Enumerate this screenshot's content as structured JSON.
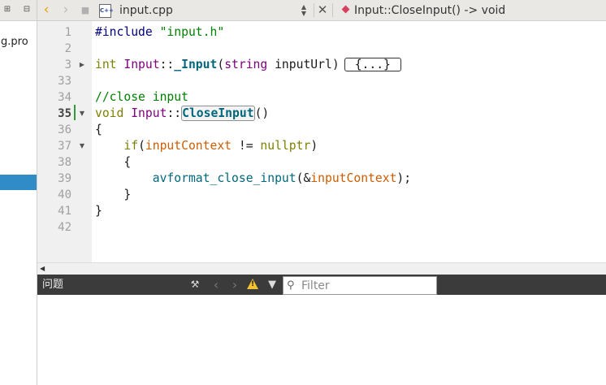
{
  "left_panel": {
    "project_label": "g.pro",
    "toolbar_icons": [
      "split-icon",
      "close-panel-icon"
    ]
  },
  "editor_toolbar": {
    "back_icon": "chevron-left-icon",
    "forward_icon": "chevron-right-icon",
    "lock_icon": "lock-icon",
    "file_type_label": "C++",
    "file_name": "input.cpp",
    "dropdown_icon": "up-down-arrows-icon",
    "close_icon": "close-icon",
    "symbol_icon": "diamond-icon",
    "symbol_label": "Input::CloseInput() -> void"
  },
  "editor": {
    "line_numbers": [
      "1",
      "2",
      "3",
      "33",
      "34",
      "35",
      "36",
      "37",
      "38",
      "39",
      "40",
      "41",
      "42"
    ],
    "current_line": "35",
    "code": {
      "l1_directive": "#include",
      "l1_string": "\"input.h\"",
      "l3_kw": "int",
      "l3_class": "Input",
      "l3_sep": "::",
      "l3_func": "_Input",
      "l3_open": "(",
      "l3_type": "string",
      "l3_param": "inputUrl",
      "l3_close": ")",
      "l3_folded": "{...}",
      "l34_comment": "//close input",
      "l35_kw": "void",
      "l35_class": "Input",
      "l35_sep": "::",
      "l35_func": "CloseInput",
      "l35_parens": "()",
      "l36_brace": "{",
      "l37_kw": "if",
      "l37_open": "(",
      "l37_var": "inputContext",
      "l37_op": " != ",
      "l37_null": "nullptr",
      "l37_close": ")",
      "l38_brace": "{",
      "l39_func": "avformat_close_input",
      "l39_open": "(&",
      "l39_var": "inputContext",
      "l39_close": ");",
      "l40_brace": "}",
      "l41_brace": "}"
    }
  },
  "issues_panel": {
    "title": "问题",
    "filter_placeholder": "Filter",
    "icons": [
      "build-icon",
      "prev-issue-icon",
      "next-issue-icon",
      "warning-icon",
      "filter-icon",
      "search-icon"
    ]
  },
  "colors": {
    "keyword": "#7f7f00",
    "type_class": "#800080",
    "function": "#00677c",
    "string_comment": "#008000",
    "variable": "#ce5c00",
    "selection": "#308cc6",
    "panel_header": "#3b3b3b"
  }
}
